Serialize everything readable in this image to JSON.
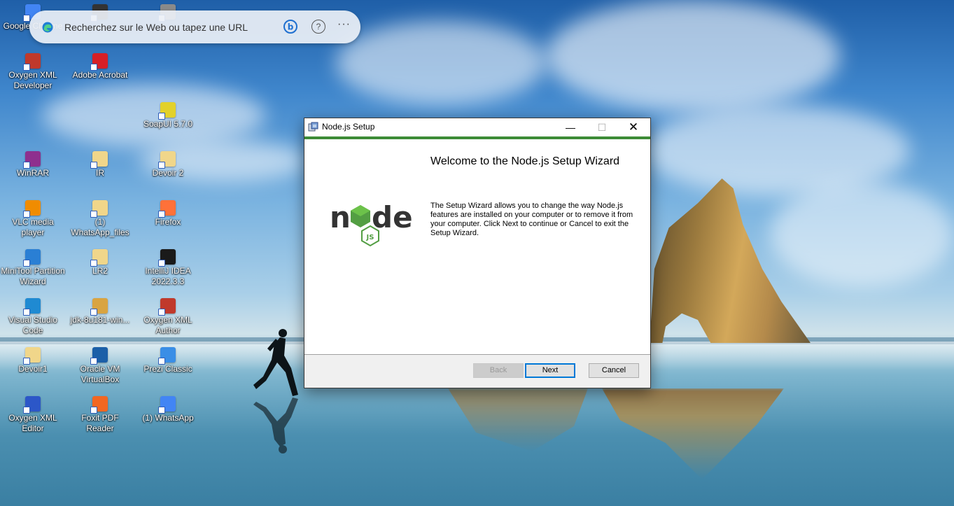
{
  "search_bar": {
    "placeholder": "Recherchez sur le Web ou tapez une URL",
    "logo_icon": "edge-icon",
    "bing_icon": "bing-icon",
    "help_icon": "help-icon",
    "more_icon": "more-options-icon",
    "more_glyph": "···",
    "help_glyph": "?"
  },
  "desktop_icons": [
    {
      "label": "Google Chrome",
      "icon": "chrome-icon",
      "color": "#4285f4"
    },
    {
      "label": "",
      "icon": "app-icon",
      "color": "#333333"
    },
    {
      "label": "",
      "icon": "app-icon",
      "color": "#8a8a8a"
    },
    {
      "label": "Oxygen XML Developer",
      "icon": "oxygen-icon",
      "color": "#c0392b"
    },
    {
      "label": "Adobe Acrobat",
      "icon": "acrobat-icon",
      "color": "#d61f26"
    },
    {
      "label": "SoapUI 5.7.0",
      "icon": "soapui-icon",
      "color": "#e2d12b"
    },
    {
      "label": "WinRAR",
      "icon": "winrar-icon",
      "color": "#8e2f8e"
    },
    {
      "label": "IR",
      "icon": "folder-icon",
      "color": "#f0d68a"
    },
    {
      "label": "Devoir 2",
      "icon": "folder-icon",
      "color": "#f0d68a"
    },
    {
      "label": "VLC media player",
      "icon": "vlc-icon",
      "color": "#f08c00"
    },
    {
      "label": "(1) WhatsApp_files",
      "icon": "folder-icon",
      "color": "#f0d68a"
    },
    {
      "label": "Firefox",
      "icon": "firefox-icon",
      "color": "#ff7139"
    },
    {
      "label": "MiniTool Partition Wizard",
      "icon": "minitool-icon",
      "color": "#2a7fd4"
    },
    {
      "label": "LR2",
      "icon": "folder-icon",
      "color": "#f0d68a"
    },
    {
      "label": "IntelliJ IDEA 2022.3.3",
      "icon": "intellij-icon",
      "color": "#1a1a1a"
    },
    {
      "label": "Visual Studio Code",
      "icon": "vscode-icon",
      "color": "#1f8ad2"
    },
    {
      "label": "jdk-8u181-win...",
      "icon": "java-installer-icon",
      "color": "#d9a441"
    },
    {
      "label": "Oxygen XML Author",
      "icon": "oxygen-icon",
      "color": "#c0392b"
    },
    {
      "label": "Devoir1",
      "icon": "folder-icon",
      "color": "#f0d68a"
    },
    {
      "label": "Oracle VM VirtualBox",
      "icon": "virtualbox-icon",
      "color": "#1b5fa8"
    },
    {
      "label": "Prezi Classic",
      "icon": "prezi-icon",
      "color": "#3a8ee6"
    },
    {
      "label": "Oxygen XML Editor",
      "icon": "oxygen-icon",
      "color": "#2c57c8"
    },
    {
      "label": "Foxit PDF Reader",
      "icon": "foxit-icon",
      "color": "#f26722"
    },
    {
      "label": "(1) WhatsApp",
      "icon": "chrome-icon",
      "color": "#4285f4"
    }
  ],
  "window": {
    "title": "Node.js Setup",
    "app_icon": "installer-icon",
    "minimize_glyph": "—",
    "maximize_glyph": "☐",
    "close_glyph": "✕",
    "accent_color": "#3d8b37",
    "heading": "Welcome to the Node.js Setup Wizard",
    "description": "The Setup Wizard allows you to change the way Node.js features are installed on your computer or to remove it from your computer. Click Next to continue or Cancel to exit the Setup Wizard.",
    "logo": {
      "wordmark_left": "n",
      "wordmark_right": "de",
      "badge": "JS",
      "dark_color": "#333333",
      "green_color": "#539e43"
    },
    "buttons": {
      "back": "Back",
      "next": "Next",
      "cancel": "Cancel"
    }
  }
}
